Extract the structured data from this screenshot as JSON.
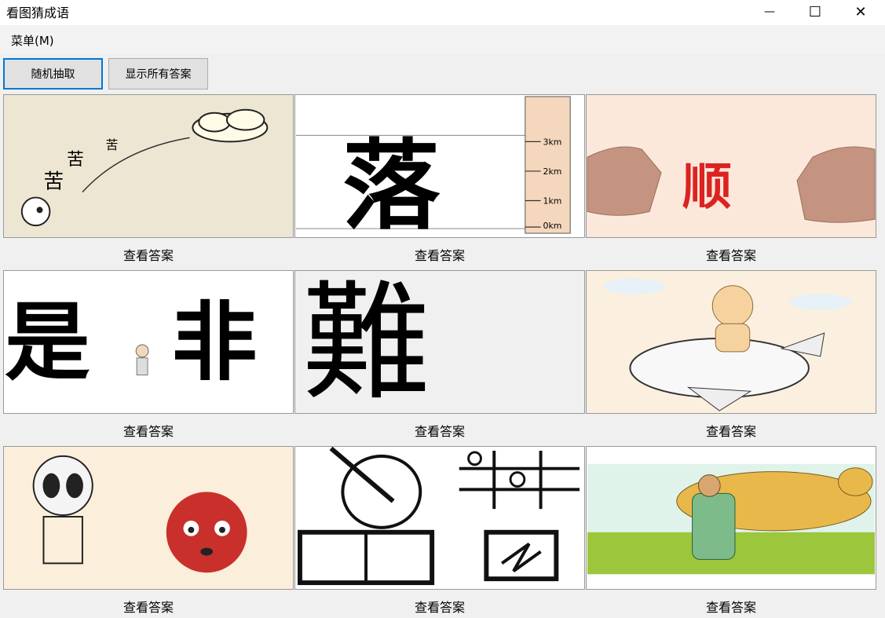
{
  "window": {
    "title": "看图猜成语",
    "minimize_glyph": "—",
    "maximize_glyph": "☐",
    "close_glyph": "✕"
  },
  "menu": {
    "label": "菜单(M)"
  },
  "toolbar": {
    "random_label": "随机抽取",
    "show_all_label": "显示所有答案"
  },
  "tiles": [
    {
      "caption": "查看答案",
      "icon": "bitter-cloud-icon",
      "text": [
        "苦",
        "苦",
        "苦"
      ]
    },
    {
      "caption": "查看答案",
      "icon": "luo-ruler-icon",
      "text": "落",
      "ruler_labels": [
        "3km",
        "2km",
        "1km",
        "0km"
      ]
    },
    {
      "caption": "查看答案",
      "icon": "shun-hands-icon",
      "text": "顺"
    },
    {
      "caption": "查看答案",
      "icon": "shi-fei-icon",
      "text": [
        "是",
        "非"
      ]
    },
    {
      "caption": "查看答案",
      "icon": "split-nan-icon",
      "text": "難"
    },
    {
      "caption": "查看答案",
      "icon": "plane-rider-icon"
    },
    {
      "caption": "查看答案",
      "icon": "skeleton-hair-icon"
    },
    {
      "caption": "查看答案",
      "icon": "qin-qi-shu-hua-icon"
    },
    {
      "caption": "查看答案",
      "icon": "man-leopard-icon"
    }
  ]
}
